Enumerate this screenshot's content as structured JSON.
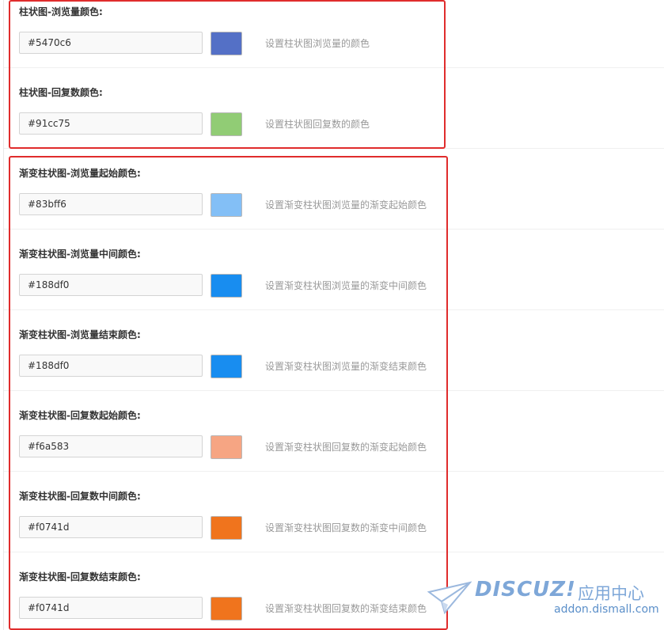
{
  "settings": [
    {
      "label": "柱状图-浏览量颜色:",
      "value": "#5470c6",
      "color": "#5470c6",
      "desc": "设置柱状图浏览量的颜色"
    },
    {
      "label": "柱状图-回复数颜色:",
      "value": "#91cc75",
      "color": "#91cc75",
      "desc": "设置柱状图回复数的颜色"
    },
    {
      "label": "渐变柱状图-浏览量起始颜色:",
      "value": "#83bff6",
      "color": "#83bff6",
      "desc": "设置渐变柱状图浏览量的渐变起始颜色"
    },
    {
      "label": "渐变柱状图-浏览量中间颜色:",
      "value": "#188df0",
      "color": "#188df0",
      "desc": "设置渐变柱状图浏览量的渐变中间颜色"
    },
    {
      "label": "渐变柱状图-浏览量结束颜色:",
      "value": "#188df0",
      "color": "#188df0",
      "desc": "设置渐变柱状图浏览量的渐变结束颜色"
    },
    {
      "label": "渐变柱状图-回复数起始颜色:",
      "value": "#f6a583",
      "color": "#f6a583",
      "desc": "设置渐变柱状图回复数的渐变起始颜色"
    },
    {
      "label": "渐变柱状图-回复数中间颜色:",
      "value": "#f0741d",
      "color": "#f0741d",
      "desc": "设置渐变柱状图回复数的渐变中间颜色"
    },
    {
      "label": "渐变柱状图-回复数结束颜色:",
      "value": "#f0741d",
      "color": "#f0741d",
      "desc": "设置渐变柱状图回复数的渐变结束颜色"
    }
  ],
  "highlight_color": "#e02c2c",
  "watermark": {
    "logo": "DISCUZ!",
    "cn": "应用中心",
    "url": "addon.dismall.com",
    "icon": "paper-plane-icon"
  }
}
